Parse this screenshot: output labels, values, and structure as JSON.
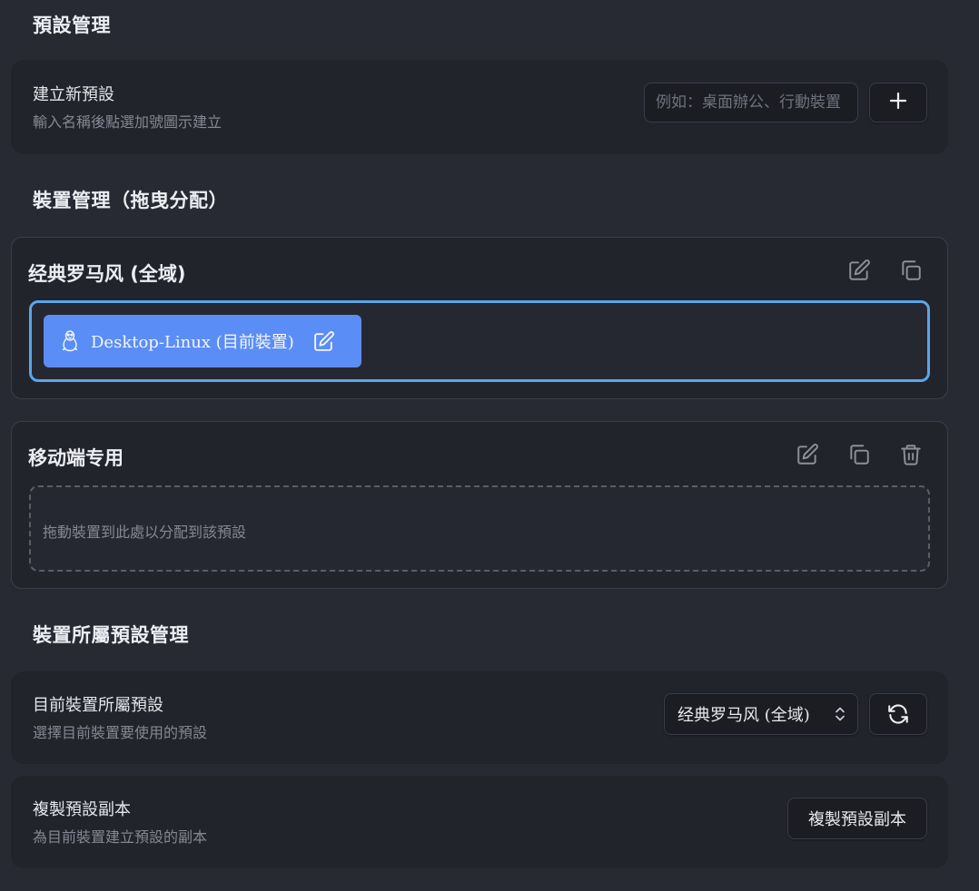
{
  "preset_management": {
    "title": "預設管理",
    "create": {
      "title": "建立新預設",
      "subtitle": "輸入名稱後點選加號圖示建立",
      "input_placeholder": "例如：桌面辦公、行動裝置",
      "input_value": "",
      "add_icon": "plus-icon"
    }
  },
  "device_management": {
    "title": "裝置管理（拖曳分配）",
    "presets": [
      {
        "name": "经典罗马风 (全域)",
        "actions": [
          "edit-icon",
          "copy-icon"
        ],
        "devices": [
          {
            "icon": "linux-penguin-icon",
            "label": "Desktop-Linux (目前裝置)",
            "edit_icon": "edit-icon"
          }
        ]
      },
      {
        "name": "移动端专用",
        "actions": [
          "edit-icon",
          "copy-icon",
          "trash-icon"
        ],
        "devices": [],
        "empty_hint": "拖動裝置到此處以分配到該預設"
      }
    ]
  },
  "device_preset_management": {
    "title": "裝置所屬預設管理",
    "current": {
      "title": "目前裝置所屬預設",
      "subtitle": "選擇目前裝置要使用的預設",
      "select_value": "经典罗马风 (全域)",
      "refresh_icon": "refresh-icon"
    },
    "duplicate": {
      "title": "複製預設副本",
      "subtitle": "為目前裝置建立預設的副本",
      "button_label": "複製預設副本"
    }
  }
}
